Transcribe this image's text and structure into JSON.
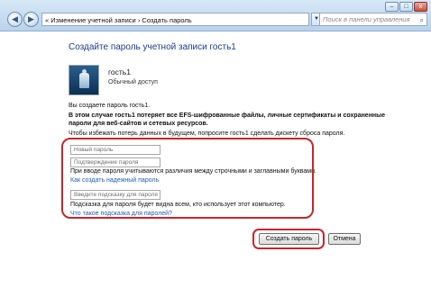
{
  "window": {
    "breadcrumb_prefix": "«",
    "breadcrumb_1": "Изменение учетной записи",
    "breadcrumb_sep": "›",
    "breadcrumb_2": "Создать пароль",
    "search_placeholder": "Поиск в панели управления",
    "controls": {
      "minimize": "–",
      "maximize": "□",
      "close": "x"
    }
  },
  "main": {
    "heading": "Создайте пароль учетной записи гость1",
    "user_name": "гость1",
    "user_type": "Обычный доступ",
    "info_line": "Вы создаете пароль гость1.",
    "warning_line1": "В этом случае гость1 потеряет все EFS-шифрованные файлы, личные сертификаты и сохраненные",
    "warning_line2": "пароли для веб-сайтов и сетевых ресурсов.",
    "advice_line": "Чтобы избежать потерь данных в будущем, попросите гость1 сделать дискету сброса пароля.",
    "password_placeholder": "Новый пароль",
    "confirm_placeholder": "Подтверждение пароля",
    "case_note": "При вводе пароля учитываются различия между строчными и заглавными буквами.",
    "strong_link": "Как создать надежный пароль",
    "hint_placeholder": "Введите подсказку для пароля",
    "hint_note": "Подсказка для пароля будет видна всем, кто использует этот компьютер.",
    "hint_link": "Что такое подсказка для паролей?"
  },
  "buttons": {
    "create": "Создать пароль",
    "cancel": "Отмена"
  },
  "colors": {
    "highlight": "#c9252b",
    "link": "#1f5fb8",
    "heading": "#1a3e8c"
  }
}
